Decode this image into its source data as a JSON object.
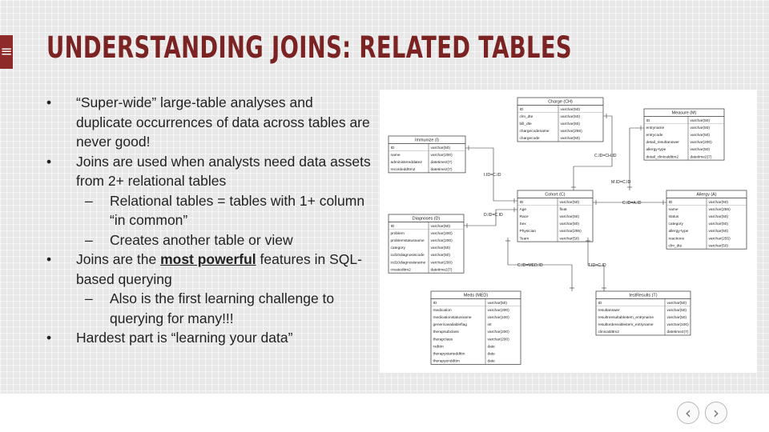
{
  "slide": {
    "menu_icon": "hamburger-icon",
    "title": "UNDERSTANDING JOINS: RELATED TABLES",
    "bullets": [
      {
        "level": 1,
        "parts": [
          {
            "text": "“Super-wide” large-table analyses and duplicate occurrences of data across tables are never good!"
          }
        ]
      },
      {
        "level": 1,
        "parts": [
          {
            "text": "Joins are used when analysts need data assets from 2+ relational tables"
          }
        ]
      },
      {
        "level": 2,
        "parts": [
          {
            "text": "Relational tables = tables with 1+ column “in common”"
          }
        ]
      },
      {
        "level": 2,
        "parts": [
          {
            "text": "Creates another table or view"
          }
        ]
      },
      {
        "level": 1,
        "parts": [
          {
            "text": "Joins are the "
          },
          {
            "text": "most powerful",
            "emph": true
          },
          {
            "text": " features in SQL-based querying"
          }
        ]
      },
      {
        "level": 2,
        "parts": [
          {
            "text": "Also is the first learning challenge to querying for many!!!"
          }
        ]
      },
      {
        "level": 1,
        "parts": [
          {
            "text": "Hardest part is “learning your data”"
          }
        ]
      }
    ]
  },
  "diagram": {
    "tables": [
      {
        "id": "charge",
        "title": "Charge (CH)",
        "rows": [
          [
            "ID",
            "varchar(50)"
          ],
          [
            "clm_dte",
            "varchar(50)"
          ],
          [
            "bill_dte",
            "varchar(50)"
          ],
          [
            "chargecodename",
            "varchar(255)"
          ],
          [
            "chargecode",
            "varchar(50)"
          ]
        ]
      },
      {
        "id": "measure",
        "title": "Measure (M)",
        "rows": [
          [
            "ID",
            "varchar(50)"
          ],
          [
            "entryname",
            "varchar(50)"
          ],
          [
            "entrycode",
            "varchar(50)"
          ],
          [
            "detail_resultanswer",
            "varchar(200)"
          ],
          [
            "allergy-type",
            "varchar(50)"
          ],
          [
            "detail_clinicaldttm2",
            "datetime2(7)"
          ]
        ]
      },
      {
        "id": "immunize",
        "title": "Immunize (I)",
        "rows": [
          [
            "ID",
            "varchar(50)"
          ],
          [
            "name",
            "varchar(200)"
          ],
          [
            "administereddate2",
            "datetime2(7)"
          ],
          [
            "recordeddttm2",
            "datetime2(7)"
          ]
        ]
      },
      {
        "id": "cohort",
        "title": "Cohort (C)",
        "rows": [
          [
            "ID",
            "varchar(50)"
          ],
          [
            "Age",
            "float"
          ],
          [
            "Race",
            "varchar(50)"
          ],
          [
            "Sex",
            "varchar(50)"
          ],
          [
            "Physician",
            "varchar(255)"
          ],
          [
            "Team",
            "varchar(50)"
          ]
        ]
      },
      {
        "id": "allergy",
        "title": "Allergy (A)",
        "rows": [
          [
            "ID",
            "varchar(50)"
          ],
          [
            "name",
            "varchar(255)"
          ],
          [
            "status",
            "varchar(50)"
          ],
          [
            "category",
            "varchar(50)"
          ],
          [
            "allergy-type",
            "varchar(50)"
          ],
          [
            "reactions",
            "varchar(255)"
          ],
          [
            "clm_dte",
            "varchar(50)"
          ]
        ]
      },
      {
        "id": "diagnoses",
        "title": "Diagnoses (D)",
        "rows": [
          [
            "ID",
            "varchar(50)"
          ],
          [
            "problem",
            "varchar(200)"
          ],
          [
            "problemstatusname",
            "varchar(200)"
          ],
          [
            "category",
            "varchar(50)"
          ],
          [
            "icd10diagnosiscode",
            "varchar(50)"
          ],
          [
            "icd10diagnosisname",
            "varchar(200)"
          ],
          [
            "createdttm2",
            "datetime2(7)"
          ]
        ]
      },
      {
        "id": "meds",
        "title": "Meds (MED)",
        "rows": [
          [
            "ID",
            "varchar(50)"
          ],
          [
            "medication",
            "varchar(200)"
          ],
          [
            "medicationstatusname",
            "varchar(100)"
          ],
          [
            "genericavailableflag",
            "int"
          ],
          [
            "therapsubclass",
            "varchar(200)"
          ],
          [
            "therapclass",
            "varchar(200)"
          ],
          [
            "rxdttm",
            "date"
          ],
          [
            "therapystarteddttm",
            "date"
          ],
          [
            "therapyenddttm",
            "date"
          ]
        ]
      },
      {
        "id": "testresults",
        "title": "testResults (T)",
        "rows": [
          [
            "ID",
            "varchar(50)"
          ],
          [
            "resultanswer",
            "varchar(50)"
          ],
          [
            "resultnresultableitem_entryname",
            "varchar(50)"
          ],
          [
            "resultordereableitem_entryname",
            "varchar(100)"
          ],
          [
            "clinicaldttm2",
            "datetime2(7)"
          ]
        ]
      }
    ],
    "relations": [
      {
        "id": "ch",
        "label": "C.ID=CH.ID"
      },
      {
        "id": "m",
        "label": "M.ID=C.ID"
      },
      {
        "id": "i",
        "label": "I.ID=C.ID"
      },
      {
        "id": "a",
        "label": "C.ID=A.ID"
      },
      {
        "id": "d",
        "label": "D.ID=C.ID"
      },
      {
        "id": "med",
        "label": "C.ID=MED.ID"
      },
      {
        "id": "t",
        "label": "T.ID=C.ID"
      }
    ]
  },
  "nav": {
    "prev_icon": "chevron-left-icon",
    "prev_glyph": "‹",
    "next_icon": "chevron-right-icon",
    "next_glyph": "›"
  }
}
